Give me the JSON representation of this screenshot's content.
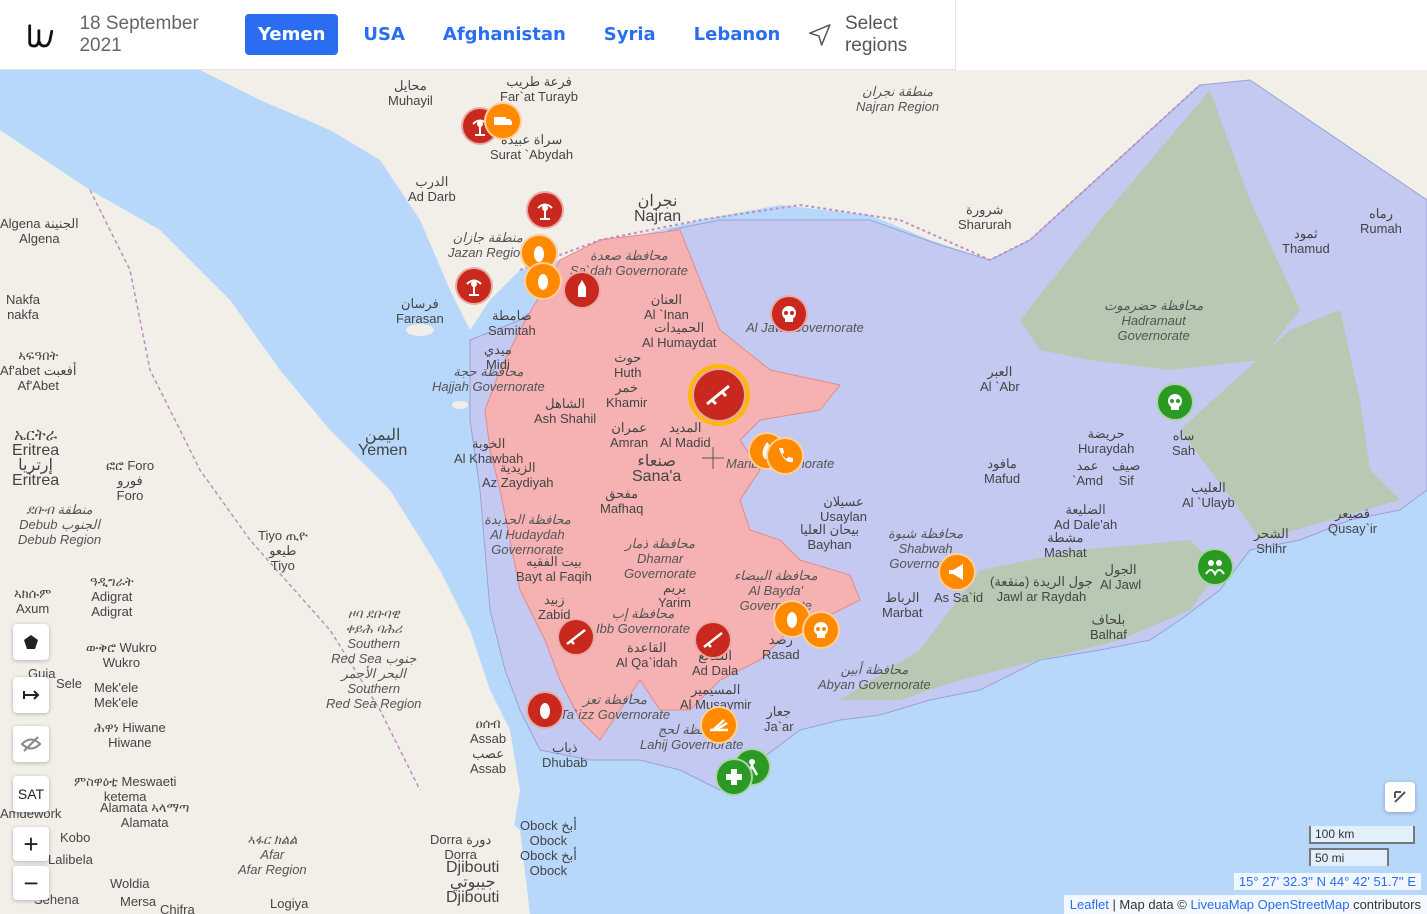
{
  "header": {
    "date": "18 September 2021",
    "tabs": [
      {
        "label": "Yemen",
        "active": true
      },
      {
        "label": "USA",
        "active": false
      },
      {
        "label": "Afghanistan",
        "active": false
      },
      {
        "label": "Syria",
        "active": false
      },
      {
        "label": "Lebanon",
        "active": false
      }
    ],
    "select_regions": "Select regions",
    "accent_color": "#2a6df0"
  },
  "map": {
    "labels": {
      "muhayil": "محايل\nMuhayil",
      "far_at_turayb": "فرعة طريب\nFar`at Turayb",
      "surat_abydah": "سراة عبيدة\nSurat `Abydah",
      "ad_darb": "الدرب\nAd Darb",
      "najran": "نجران\nNajran",
      "najran_region": "منطقة نجران\nNajran Region",
      "sharurah": "شرورة\nSharurah",
      "jazan_region": "منطقة جازان\nJazan Region",
      "saadah_gov": "محافظة صعدة\nSa`dah Governorate",
      "farasan": "فرسان\nFarasan",
      "samitah": "صامطة\nSamitah",
      "midi": "ميدي\nMidi",
      "al_inan": "العنان\nAl `Inan",
      "al_humaydat": "الحميدات\nAl Humaydat",
      "al_jawf_gov": "Al Jawf Governorate",
      "hajjah_gov": "محافظة حجة\nHajjah Governorate",
      "huth": "حوث\nHuth",
      "khamir": "خمر\nKhamir",
      "ash_shahil": "الشاهل\nAsh Shahil",
      "amran": "عمران\nAmran",
      "al_madid": "المديد\nAl Madid",
      "marib_gov": "Marib Governorate",
      "yemen": "اليمن\nYemen",
      "al_khawbah": "الخوبة\nAl Khawbah",
      "az_zaydiyah": "الزيدية\nAz Zaydiyah",
      "sanaa": "صنعاء\nSana'a",
      "mafhaq": "مفحق\nMafhaq",
      "al_abr": "العبر\nAl `Abr",
      "hadramaut_gov": "محافظة حضرموت\nHadramaut\nGovernorate",
      "thamud": "ثمود\nThamud",
      "rumah": "رماه\nRumah",
      "huraydah": "حريضة\nHuraydah",
      "sah": "ساه\nSah",
      "mafud": "مافود\nMafud",
      "amd": "عمد\n`Amd",
      "sif": "صيف\nSif",
      "al_ulayb": "العليب\nAl `Ulayb",
      "usaylan": "عسيلان\nUsaylan",
      "bayhan": "بيحان العليا\nBayhan",
      "shabwah_gov": "محافظة شبوة\nShabwah\nGovernorate",
      "ad_dalah": "الضليعة\nAd Dale'ah",
      "mashat": "مشطة\nMashat",
      "qusayir": "قصيعر\nQusay`ir",
      "shihr": "الشحر\nShihr",
      "al_hudaydah_gov": "محافظة الحديدة\nAl Hudaydah\nGovernorate",
      "dhamar_gov": "محافظة ذمار\nDhamar\nGovernorate",
      "bayt_al_faqih": "بيت الفقيه\nBayt al Faqih",
      "yarim": "يريم\nYarim",
      "al_bayda": "محافظة البيضاء\nAl Bayda'\nGovernorate",
      "marbat": "الرباط\nMarbat",
      "as_said": "As Sa`id",
      "jawl_ar_raydah": "جول الريدة (منقعة)\nJawl ar Raydah",
      "al_jawl": "الجول\nAl Jawl",
      "balhaf": "بلحاف\nBalhaf",
      "zabid": "زبيد\nZabid",
      "ibb_gov": "محافظة إب\nIbb Governorate",
      "rasad": "رصد\nRasad",
      "al_qaidah": "القاعدة\nAl Qa`idah",
      "ad_dala": "الضالع\nAd Dala",
      "abyan_gov": "محافظة أبين\nAbyan Governorate",
      "al_musaymir": "المسيمير\nAl Musaymir",
      "taiz_gov": "محافظة تعز\nTa`izz Governorate",
      "lahij_gov": "محافظة لحج\nLahij Governorate",
      "jaar": "جعار\nJa`ar",
      "dhubab": "ذباب\nDhubab",
      "assab": "ዐሰብ\nAssab\nعصب\nAssab",
      "eritrea": "ኤርትራ\nEritrea\nإرتريا\nEritrea",
      "debub": "ደቡብ منطقة\nDebub الجنوب\nDebub Region",
      "foro": "ፎሮ Foro\nفورو\nForo",
      "tiyo": "Tiyo ጢዮ\nطيعو\nTiyo",
      "adigrat": "ዓዲግራት\nAdigrat\nAdigrat",
      "southern_red_sea": "ዞባ ደቡባዊ\nቀይሕ ባሕሪ\nSouthern\nRed Sea جنوب\nالبحر الأحمر\nSouthern\nRed Sea Region",
      "wukro": "ውቅሮ Wukro\nWukro",
      "mekele": "Mek'ele\nMek'ele",
      "hiwane": "ሕዋነ Hiwane\nHiwane",
      "meswaeti": "ምስዋዕቲ Meswaeti\nketema",
      "alamata": "Alamata ኣላማጣ\nAlamata",
      "afar": "ኣፋር ክልል\nAfar\nAfar Region",
      "dorra": "Dorra دورة\nDorra",
      "obock": "Obock أبخ\nObock\nObock أبخ\nObock",
      "djibouti": "Djibouti\nجيبوتي\nDjibouti",
      "nakfa": "Nakfa\nnakfa",
      "afabet": "ኣፍዓበት\nAf'abet أفعبت\nAf'Abet",
      "algena": "Algena الجنينة\nAlgena",
      "axum": "ኣክሱም\nAxum",
      "sele": "Sele",
      "woldia": "Woldia",
      "mersa": "Mersa",
      "chifra": "Chifra",
      "logiya": "Logiya",
      "kobo": "Kobo",
      "lalibela": "Lalibela",
      "sehena": "Sehena",
      "amdework": "Amdework",
      "guia": "Guia"
    },
    "markers": [
      {
        "icon": "radio-tower-icon",
        "color": "red"
      },
      {
        "icon": "truck-icon",
        "color": "orange"
      },
      {
        "icon": "radio-tower-icon",
        "color": "red"
      },
      {
        "icon": "bomb-icon",
        "color": "orange"
      },
      {
        "icon": "bomb-icon",
        "color": "orange"
      },
      {
        "icon": "radio-tower-icon",
        "color": "red"
      },
      {
        "icon": "missile-icon",
        "color": "red"
      },
      {
        "icon": "skull-icon",
        "color": "red"
      },
      {
        "icon": "rifle-icon",
        "color": "red",
        "highlighted": true
      },
      {
        "icon": "flame-icon",
        "color": "orange"
      },
      {
        "icon": "phone-icon",
        "color": "orange"
      },
      {
        "icon": "skull-icon",
        "color": "green"
      },
      {
        "icon": "megaphone-icon",
        "color": "orange"
      },
      {
        "icon": "group-icon",
        "color": "green"
      },
      {
        "icon": "rifle-icon",
        "color": "red"
      },
      {
        "icon": "rifle-icon",
        "color": "red"
      },
      {
        "icon": "bomb-icon",
        "color": "orange"
      },
      {
        "icon": "skull-icon",
        "color": "orange"
      },
      {
        "icon": "bomb-icon",
        "color": "red"
      },
      {
        "icon": "rocket-launcher-icon",
        "color": "orange"
      },
      {
        "icon": "medical-icon",
        "color": "green"
      },
      {
        "icon": "people-icon",
        "color": "green"
      }
    ],
    "controls": {
      "polygon": "polygon-icon",
      "measure": "measure-icon",
      "hide": "eye-off-icon",
      "sat_label": "SAT",
      "zoom_in": "+",
      "zoom_out": "−"
    },
    "scale": {
      "km": "100 km",
      "mi": "50 mi"
    },
    "coordinates": "15° 27' 32.3'' N 44° 42' 51.7'' E",
    "attribution": {
      "leaflet": "Leaflet",
      "sep": " | Map data © ",
      "liveuamap": "LiveuaMap",
      "osm": "OpenStreetMap",
      "contributors": " contributors"
    },
    "colors": {
      "sea": "#b7d7fb",
      "land": "#f2efe9",
      "houthi": "#f6b2b2",
      "govt": "#c3c9f0",
      "stc": "#b7c9b2"
    }
  }
}
